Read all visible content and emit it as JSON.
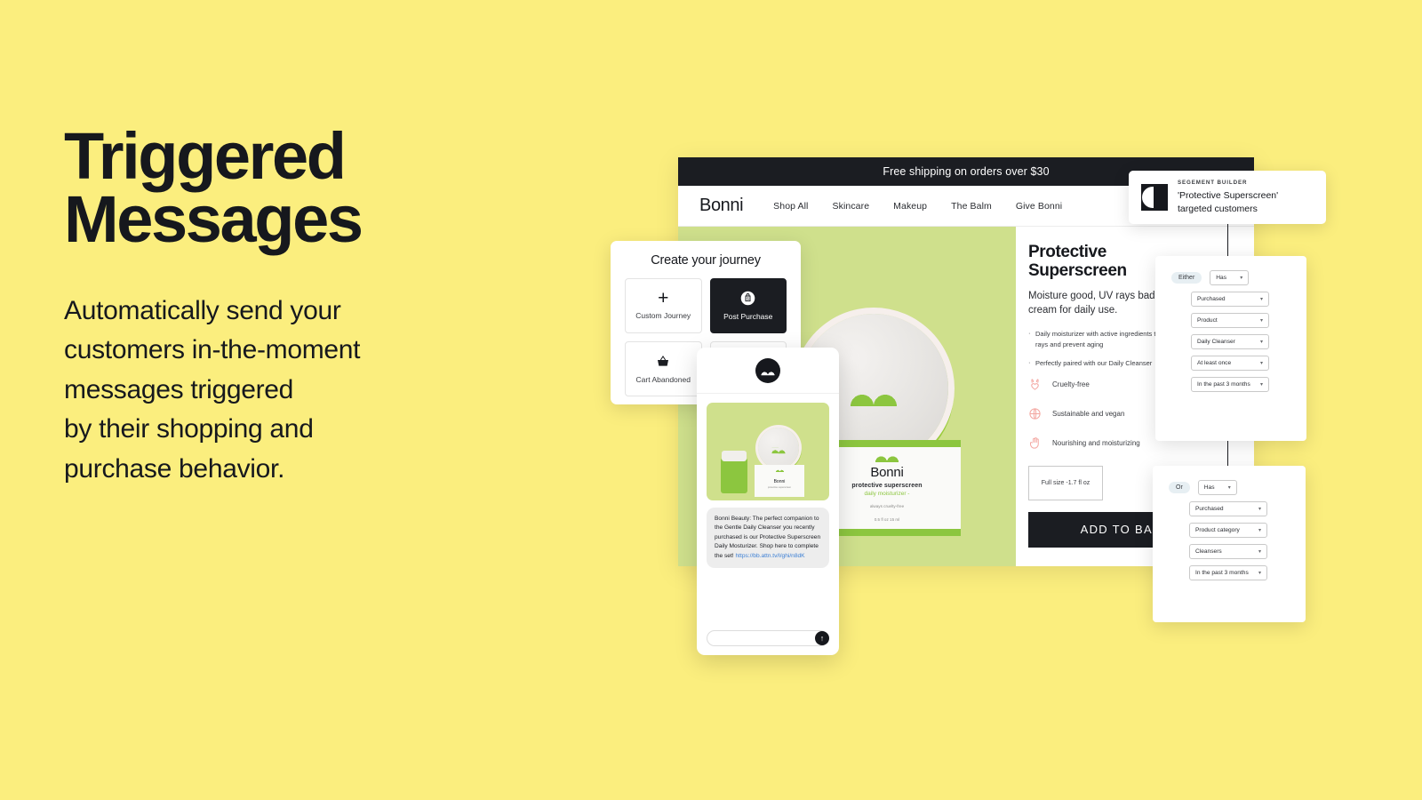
{
  "hero": {
    "headline_line1": "Triggered",
    "headline_line2": "Messages",
    "subcopy_lines": [
      "Automatically send your",
      "customers in-the-moment",
      "messages triggered",
      "by their shopping and",
      "purchase behavior."
    ],
    "background_color": "#FBEE7E",
    "text_color": "#16181D"
  },
  "site": {
    "banner": "Free shipping on orders over $30",
    "brand": "Bonni",
    "nav": [
      "Shop All",
      "Skincare",
      "Makeup",
      "The Balm",
      "Give Bonni"
    ],
    "product": {
      "title_line1": "Protective",
      "title_line2": "Superscreen",
      "description": "Moisture good, UV rays bad. A moisturizing cream for daily use.",
      "bullets": [
        "Daily moisturizer with active ingredients to protect from harmful UV rays and prevent aging",
        "Perfectly paired with our Daily Cleanser"
      ],
      "features": [
        {
          "icon": "bunny-icon",
          "label": "Cruelty-free"
        },
        {
          "icon": "globe-icon",
          "label": "Sustainable and vegan"
        },
        {
          "icon": "hand-icon",
          "label": "Nourishing and moisturizing"
        }
      ],
      "size_option": "Full size -1.7 fl oz",
      "add_to_bag": "ADD TO BAG"
    },
    "packaging": {
      "brand": "Bonni",
      "line1": "protective superscreen",
      "line2": "daily moisturizer -",
      "fine1": "always cruelty-free",
      "fine2": "0.5 fl oz 15 ml"
    }
  },
  "journey": {
    "title": "Create your journey",
    "cards": [
      {
        "label": "Custom Journey",
        "icon": "plus-icon",
        "selected": false
      },
      {
        "label": "Post Purchase",
        "icon": "shopping-bag-dollar-icon",
        "selected": true
      },
      {
        "label": "Cart Abandoned",
        "icon": "basket-icon",
        "selected": false
      },
      {
        "label": "",
        "icon": "",
        "selected": false
      }
    ]
  },
  "phone": {
    "avatar_icon": "bonni-logo-icon",
    "message": "Bonni Beauty: The perfect companion to the Gentle Daily Cleanser you recently purchased is our Protective Superscreen Daily Mosturizer. Shop here to complete the set!",
    "link": "https://bb.attn.tv/l/ghi/n8dK",
    "input_placeholder": "",
    "send_icon": "arrow-up-icon"
  },
  "segment_callout": {
    "kicker": "SEGEMENT BUILDER",
    "title_line1": "'Protective Superscreen'",
    "title_line2": "targeted customers",
    "logo_icon": "attentive-logo-icon"
  },
  "conditions": [
    {
      "operator": "Either",
      "fields": [
        {
          "value": "Has",
          "width": "small"
        },
        {
          "value": "Purchased",
          "width": "wide"
        },
        {
          "value": "Product",
          "width": "wide"
        },
        {
          "value": "Daily Cleanser",
          "width": "wide"
        },
        {
          "value": "At least once",
          "width": "wide"
        },
        {
          "value": "In the past 3 months",
          "width": "wide"
        }
      ]
    },
    {
      "operator": "Or",
      "fields": [
        {
          "value": "Has",
          "width": "small"
        },
        {
          "value": "Purchased",
          "width": "wide"
        },
        {
          "value": "Product category",
          "width": "wide"
        },
        {
          "value": "Cleansers",
          "width": "wide"
        },
        {
          "value": "In the past 3 months",
          "width": "wide"
        }
      ]
    }
  ]
}
